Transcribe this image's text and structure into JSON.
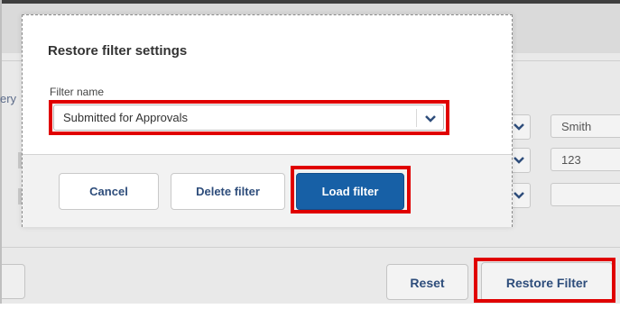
{
  "modal": {
    "title": "Restore filter settings",
    "field_label": "Filter name",
    "selected_filter": "Submitted for Approvals",
    "buttons": {
      "cancel": "Cancel",
      "delete": "Delete filter",
      "load": "Load filter"
    }
  },
  "background": {
    "edge_text": "ery",
    "inputs": [
      "Smith",
      "123",
      ""
    ],
    "reset_label": "Reset",
    "restore_label": "Restore Filter"
  },
  "colors": {
    "highlight": "#e00000",
    "primary_button": "#1760a6",
    "link_text": "#2e4d7b"
  }
}
